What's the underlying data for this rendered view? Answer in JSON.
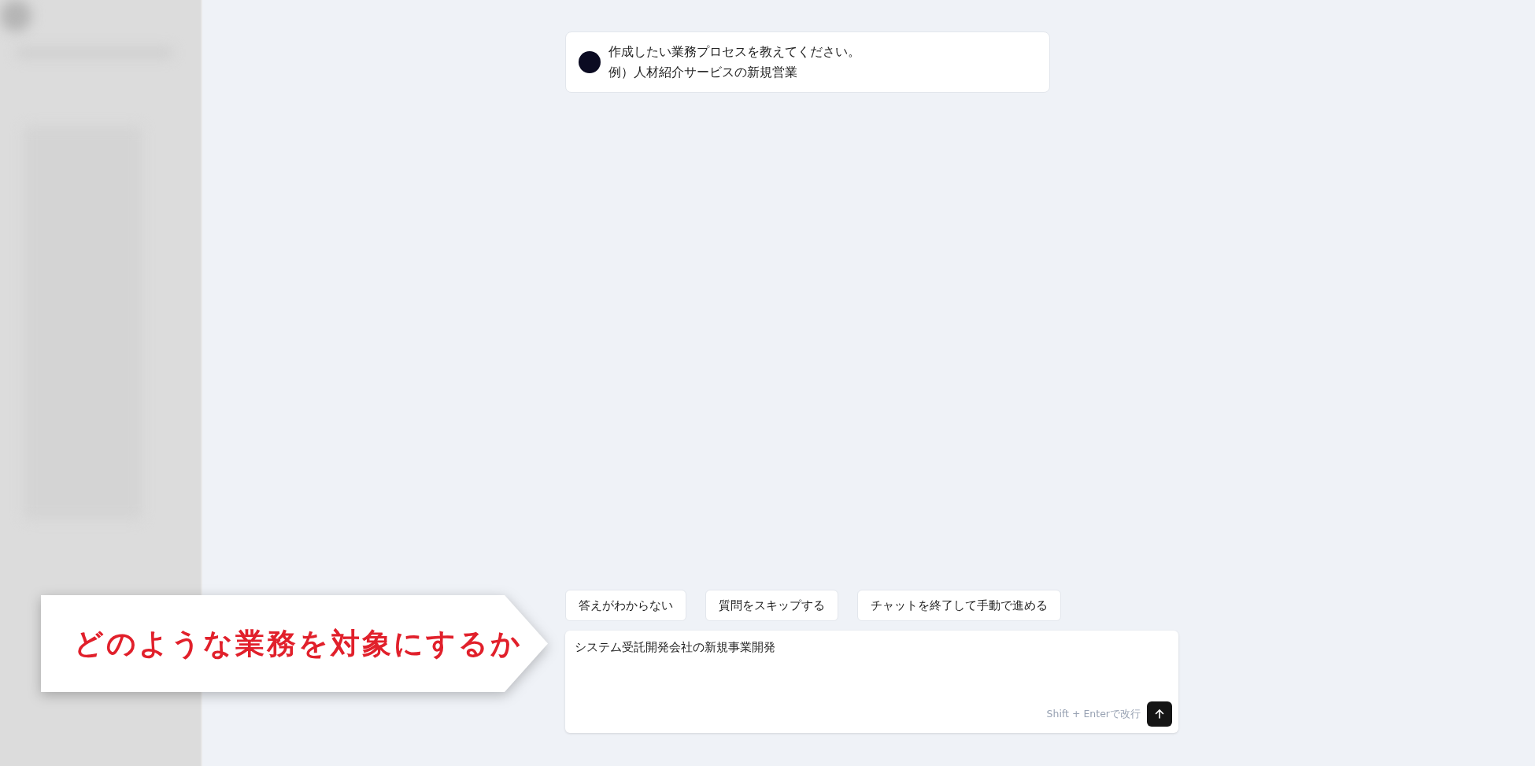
{
  "message": {
    "lines": [
      "作成したい業務プロセスを教えてください。",
      "例）人材紹介サービスの新規営業"
    ]
  },
  "quick_replies": [
    "答えがわからない",
    "質問をスキップする",
    "チャットを終了して手動で進める"
  ],
  "input": {
    "value": "システム受託開発会社の新規事業開発",
    "hint": "Shift + Enterで改行"
  },
  "callout": {
    "text": "どのような業務を対象にするか"
  }
}
